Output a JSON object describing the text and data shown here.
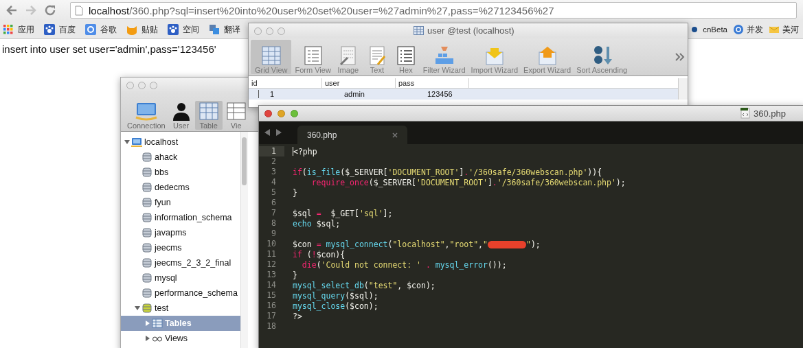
{
  "address_bar": {
    "host": "localhost",
    "path": "/360.php?sql=insert%20into%20user%20set%20user=%27admin%27,pass=%27123456%27"
  },
  "bookmarks": [
    {
      "label": "应用",
      "kind": "apps"
    },
    {
      "label": "百度",
      "kind": "paw"
    },
    {
      "label": "谷歌",
      "kind": "google"
    },
    {
      "label": "贴贴",
      "kind": "cat"
    },
    {
      "label": "空间",
      "kind": "paw"
    },
    {
      "label": "翻译",
      "kind": "translate"
    }
  ],
  "bookmarks_right": [
    {
      "label": "cnBeta",
      "kind": "dot"
    },
    {
      "label": "并发",
      "kind": "globe"
    },
    {
      "label": "美河",
      "kind": "envelope"
    }
  ],
  "page_output": "insert into user set user='admin',pass='123456'",
  "table_window": {
    "title": "user @test (localhost)",
    "tools": [
      {
        "label": "Grid View",
        "kind": "grid",
        "selected": true
      },
      {
        "label": "Form View",
        "kind": "form",
        "selected": false
      },
      {
        "label": "Image",
        "kind": "image",
        "selected": false
      },
      {
        "label": "Text",
        "kind": "text",
        "selected": false
      },
      {
        "label": "Hex",
        "kind": "hex",
        "selected": false
      },
      {
        "label": "Filter Wizard",
        "kind": "filter",
        "selected": false
      },
      {
        "label": "Import Wizard",
        "kind": "import",
        "selected": false
      },
      {
        "label": "Export Wizard",
        "kind": "export",
        "selected": false
      },
      {
        "label": "Sort Ascending",
        "kind": "sort",
        "selected": false
      }
    ],
    "columns": [
      "id",
      "user",
      "pass"
    ],
    "rows": [
      {
        "cells": [
          "1",
          "admin",
          "123456"
        ],
        "selected": true
      }
    ]
  },
  "main_window": {
    "tools": [
      {
        "label": "Connection",
        "kind": "connection",
        "selected": false
      },
      {
        "label": "User",
        "kind": "user",
        "selected": false
      },
      {
        "label": "Table",
        "kind": "table",
        "selected": true
      },
      {
        "label": "Vie",
        "kind": "view",
        "selected": false
      }
    ],
    "tree": [
      {
        "label": "localhost",
        "kind": "server",
        "expanded": true,
        "selected": false,
        "children": [
          {
            "label": "ahack",
            "kind": "database",
            "selected": false
          },
          {
            "label": "bbs",
            "kind": "database",
            "selected": false
          },
          {
            "label": "dedecms",
            "kind": "database",
            "selected": false
          },
          {
            "label": "fyun",
            "kind": "database",
            "selected": false
          },
          {
            "label": "information_schema",
            "kind": "database",
            "selected": false
          },
          {
            "label": "javapms",
            "kind": "database",
            "selected": false
          },
          {
            "label": "jeecms",
            "kind": "database",
            "selected": false
          },
          {
            "label": "jeecms_2_3_2_final",
            "kind": "database",
            "selected": false
          },
          {
            "label": "mysql",
            "kind": "database",
            "selected": false
          },
          {
            "label": "performance_schema",
            "kind": "database",
            "selected": false
          },
          {
            "label": "test",
            "kind": "database",
            "expanded": true,
            "selected": false,
            "children": [
              {
                "label": "Tables",
                "kind": "tables",
                "expanded": false,
                "selected": true
              },
              {
                "label": "Views",
                "kind": "views",
                "expanded": false,
                "selected": false
              }
            ]
          }
        ]
      }
    ]
  },
  "editor": {
    "title": "360.php",
    "tabs": [
      {
        "label": "360.php",
        "selected": true
      }
    ],
    "lines": [
      {
        "number": "1",
        "current": true,
        "tokens": [
          {
            "text": "<?php",
            "kind": "plain"
          }
        ]
      },
      {
        "number": "2",
        "current": false
      },
      {
        "number": "3",
        "current": false,
        "tokens": [
          {
            "text": "if",
            "kind": "keyword"
          },
          {
            "text": "(",
            "kind": "plain"
          },
          {
            "text": "is_file",
            "kind": "func"
          },
          {
            "text": "($_SERVER[",
            "kind": "plain"
          },
          {
            "text": "'DOCUMENT_ROOT'",
            "kind": "string"
          },
          {
            "text": "]",
            "kind": "plain"
          },
          {
            "text": ".",
            "kind": "keyword"
          },
          {
            "text": "'/360safe/360webscan.php'",
            "kind": "string"
          },
          {
            "text": ")){",
            "kind": "plain"
          }
        ]
      },
      {
        "number": "4",
        "current": false,
        "tokens": [
          {
            "text": "    require_once",
            "kind": "keyword"
          },
          {
            "text": "($_SERVER[",
            "kind": "plain"
          },
          {
            "text": "'DOCUMENT_ROOT'",
            "kind": "string"
          },
          {
            "text": "]",
            "kind": "plain"
          },
          {
            "text": ".",
            "kind": "keyword"
          },
          {
            "text": "'/360safe/360webscan.php'",
            "kind": "string"
          },
          {
            "text": ");",
            "kind": "plain"
          }
        ]
      },
      {
        "number": "5",
        "current": false,
        "tokens": [
          {
            "text": "}",
            "kind": "plain"
          }
        ]
      },
      {
        "number": "6",
        "current": false
      },
      {
        "number": "7",
        "current": false,
        "tokens": [
          {
            "text": "$sql ",
            "kind": "plain"
          },
          {
            "text": "=",
            "kind": "keyword"
          },
          {
            "text": "  $_GET[",
            "kind": "plain"
          },
          {
            "text": "'sql'",
            "kind": "string"
          },
          {
            "text": "];",
            "kind": "plain"
          }
        ]
      },
      {
        "number": "8",
        "current": false,
        "tokens": [
          {
            "text": "echo",
            "kind": "func"
          },
          {
            "text": " $sql;",
            "kind": "plain"
          }
        ]
      },
      {
        "number": "9",
        "current": false
      },
      {
        "number": "10",
        "current": false,
        "tokens": [
          {
            "text": "$con ",
            "kind": "plain"
          },
          {
            "text": "= ",
            "kind": "keyword"
          },
          {
            "text": "mysql_connect",
            "kind": "func"
          },
          {
            "text": "(",
            "kind": "plain"
          },
          {
            "text": "\"localhost\"",
            "kind": "string"
          },
          {
            "text": ",",
            "kind": "plain"
          },
          {
            "text": "\"root\"",
            "kind": "string"
          },
          {
            "text": ",",
            "kind": "plain"
          },
          {
            "text": "\"",
            "kind": "string"
          },
          {
            "kind": "redacted"
          },
          {
            "text": "\"",
            "kind": "string"
          },
          {
            "text": ");",
            "kind": "plain"
          }
        ]
      },
      {
        "number": "11",
        "current": false,
        "tokens": [
          {
            "text": "if",
            "kind": "keyword"
          },
          {
            "text": " (",
            "kind": "plain"
          },
          {
            "text": "!",
            "kind": "keyword"
          },
          {
            "text": "$con){",
            "kind": "plain"
          }
        ]
      },
      {
        "number": "12",
        "current": false,
        "tokens": [
          {
            "text": "  die",
            "kind": "keyword"
          },
          {
            "text": "(",
            "kind": "plain"
          },
          {
            "text": "'Could not connect: '",
            "kind": "string"
          },
          {
            "text": " . ",
            "kind": "keyword"
          },
          {
            "text": "mysql_error",
            "kind": "func"
          },
          {
            "text": "());",
            "kind": "plain"
          }
        ]
      },
      {
        "number": "13",
        "current": false,
        "tokens": [
          {
            "text": "}",
            "kind": "plain"
          }
        ]
      },
      {
        "number": "14",
        "current": false,
        "tokens": [
          {
            "text": "mysql_select_db",
            "kind": "func"
          },
          {
            "text": "(",
            "kind": "plain"
          },
          {
            "text": "\"test\"",
            "kind": "string"
          },
          {
            "text": ", $con);",
            "kind": "plain"
          }
        ]
      },
      {
        "number": "15",
        "current": false,
        "tokens": [
          {
            "text": "mysql_query",
            "kind": "func"
          },
          {
            "text": "($sql);",
            "kind": "plain"
          }
        ]
      },
      {
        "number": "16",
        "current": false,
        "tokens": [
          {
            "text": "mysql_close",
            "kind": "func"
          },
          {
            "text": "($con);",
            "kind": "plain"
          }
        ]
      },
      {
        "number": "17",
        "current": false,
        "tokens": [
          {
            "text": "?>",
            "kind": "plain"
          }
        ]
      },
      {
        "number": "18",
        "current": false
      }
    ]
  }
}
